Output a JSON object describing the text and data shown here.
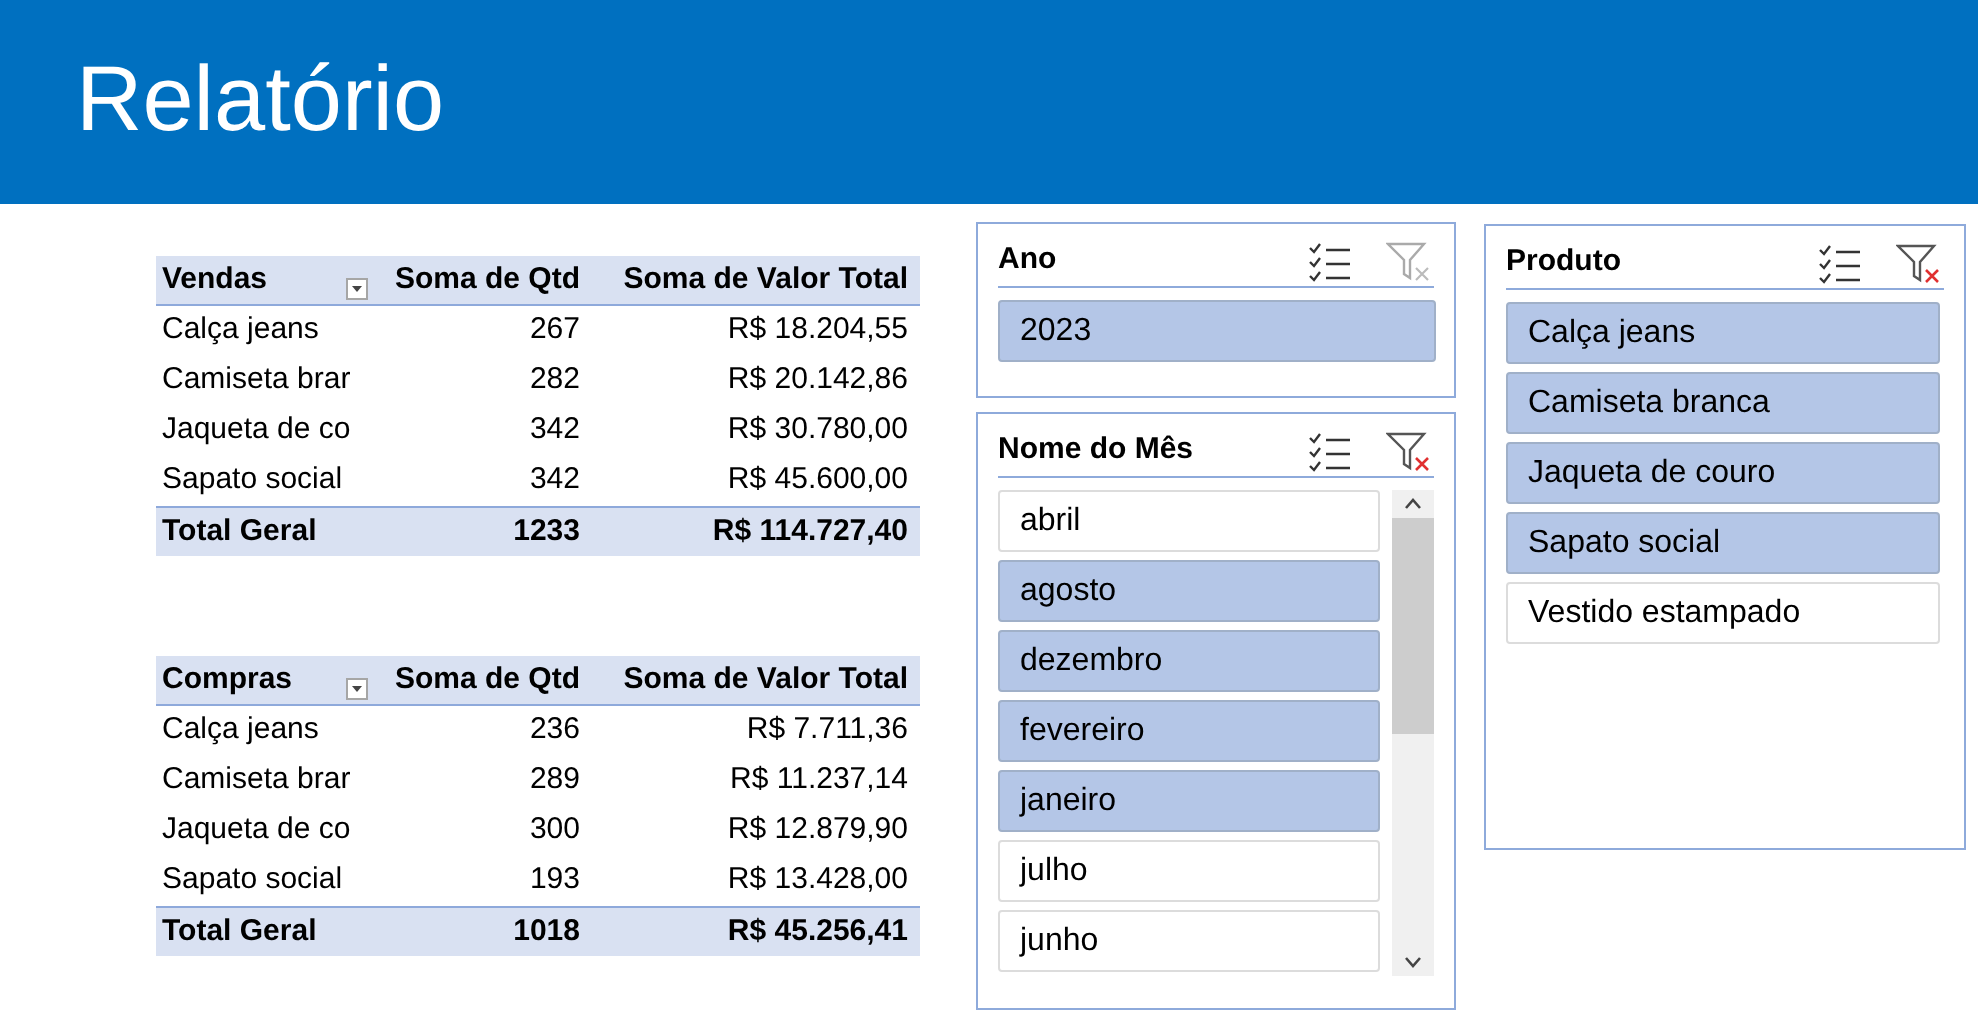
{
  "header": {
    "title": "Relatório"
  },
  "pivot_tables": [
    {
      "columns": [
        "Vendas",
        "Soma de Qtd",
        "Soma de Valor Total"
      ],
      "rows": [
        [
          "Calça jeans",
          "267",
          "R$ 18.204,55"
        ],
        [
          "Camiseta brar",
          "282",
          "R$ 20.142,86"
        ],
        [
          "Jaqueta de co",
          "342",
          "R$ 30.780,00"
        ],
        [
          "Sapato social",
          "342",
          "R$ 45.600,00"
        ]
      ],
      "total": [
        "Total Geral",
        "1233",
        "R$ 114.727,40"
      ]
    },
    {
      "columns": [
        "Compras",
        "Soma de Qtd",
        "Soma de Valor Total"
      ],
      "rows": [
        [
          "Calça jeans",
          "236",
          "R$ 7.711,36"
        ],
        [
          "Camiseta brar",
          "289",
          "R$ 11.237,14"
        ],
        [
          "Jaqueta de co",
          "300",
          "R$ 12.879,90"
        ],
        [
          "Sapato social",
          "193",
          "R$ 13.428,00"
        ]
      ],
      "total": [
        "Total Geral",
        "1018",
        "R$ 45.256,41"
      ]
    }
  ],
  "slicers": [
    {
      "title": "Ano",
      "clear_filter_enabled": false,
      "items": [
        {
          "label": "2023",
          "selected": true
        }
      ]
    },
    {
      "title": "Nome do Mês",
      "clear_filter_enabled": true,
      "items": [
        {
          "label": "abril",
          "selected": false
        },
        {
          "label": "agosto",
          "selected": true
        },
        {
          "label": "dezembro",
          "selected": true
        },
        {
          "label": "fevereiro",
          "selected": true
        },
        {
          "label": "janeiro",
          "selected": true
        },
        {
          "label": "julho",
          "selected": false
        },
        {
          "label": "junho",
          "selected": false
        }
      ]
    },
    {
      "title": "Produto",
      "clear_filter_enabled": true,
      "items": [
        {
          "label": "Calça jeans",
          "selected": true
        },
        {
          "label": "Camiseta branca",
          "selected": true
        },
        {
          "label": "Jaqueta de couro",
          "selected": true
        },
        {
          "label": "Sapato social",
          "selected": true
        },
        {
          "label": "Vestido estampado",
          "selected": false
        }
      ]
    }
  ]
}
